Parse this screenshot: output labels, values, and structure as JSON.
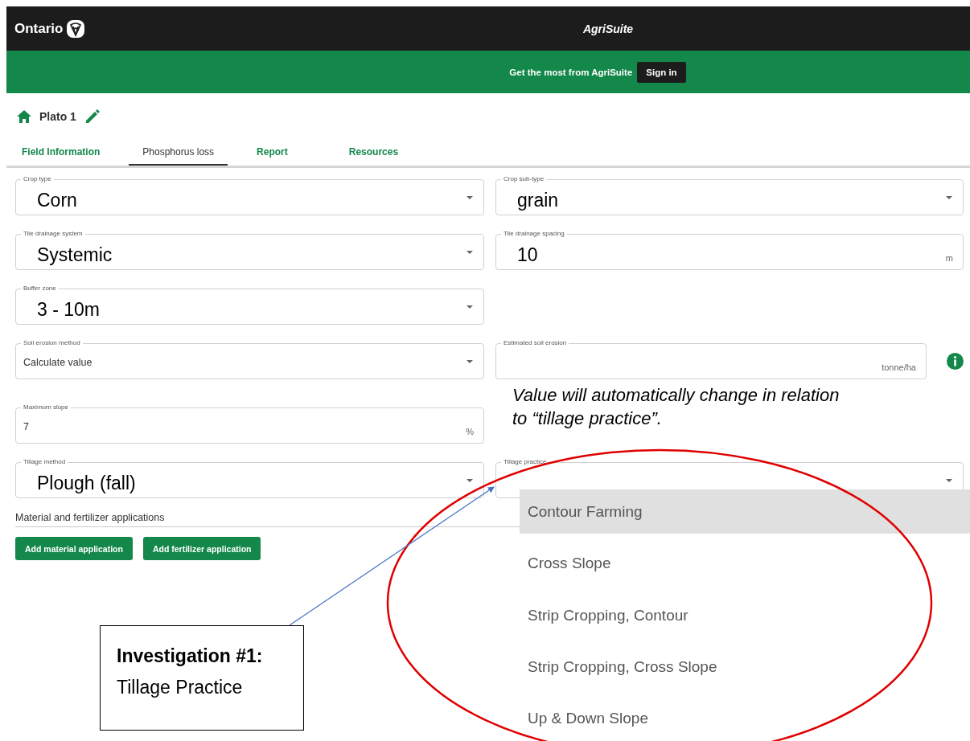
{
  "header": {
    "logo": "Ontario",
    "app_title": "AgriSuite"
  },
  "banner": {
    "text": "Get the most from AgriSuite",
    "button": "Sign in"
  },
  "field_name": "Plato 1",
  "tabs": [
    {
      "label": "Field Information",
      "selected": false
    },
    {
      "label": "Phosphorus loss",
      "selected": true
    },
    {
      "label": "Report",
      "selected": false
    },
    {
      "label": "Resources",
      "selected": false
    }
  ],
  "form_rows": [
    {
      "left": {
        "label": "Crop type",
        "kind": "select",
        "value": "Corn",
        "handwritten": true
      },
      "right": {
        "label": "Crop sub-type",
        "kind": "select",
        "value": "grain",
        "handwritten": true
      }
    },
    {
      "left": {
        "label": "Tile drainage system",
        "kind": "select",
        "value": "Systemic",
        "handwritten": true
      },
      "right": {
        "label": "Tile drainage spacing",
        "kind": "number",
        "value": "10",
        "unit": "m",
        "handwritten": true
      }
    },
    {
      "left": {
        "label": "Buffer zone",
        "kind": "select",
        "value": "3 - 10m",
        "handwritten": true
      }
    },
    {
      "left": {
        "label": "Soil erosion method",
        "kind": "select",
        "value": "Calculate value",
        "handwritten": false
      },
      "right": {
        "label": "Estimated soil erosion",
        "kind": "number",
        "unit": "tonne/ha",
        "info": true
      }
    },
    {
      "left": {
        "label": "Maximum slope",
        "kind": "number",
        "value": "7",
        "unit": "%",
        "handwritten": false
      }
    },
    {
      "left": {
        "label": "Tillage method",
        "kind": "select",
        "value": "Plough (fall)",
        "handwritten": true
      },
      "right": {
        "label": "Tillage practice",
        "kind": "select"
      }
    }
  ],
  "applications": {
    "heading": "Material and fertilizer applications",
    "buttons": [
      "Add material application",
      "Add fertilizer application"
    ]
  },
  "tillage_menu": [
    {
      "label": "Contour Farming",
      "selected": true
    },
    {
      "label": "Cross Slope",
      "selected": false
    },
    {
      "label": "Strip Cropping, Contour",
      "selected": false
    },
    {
      "label": "Strip Cropping, Cross Slope",
      "selected": false
    },
    {
      "label": "Up & Down Slope",
      "selected": false
    }
  ],
  "annotations": {
    "note": "Value will automatically change in relation to “tillage practice”.",
    "callout_title": "Investigation #1:",
    "callout_text": "Tillage Practice"
  }
}
